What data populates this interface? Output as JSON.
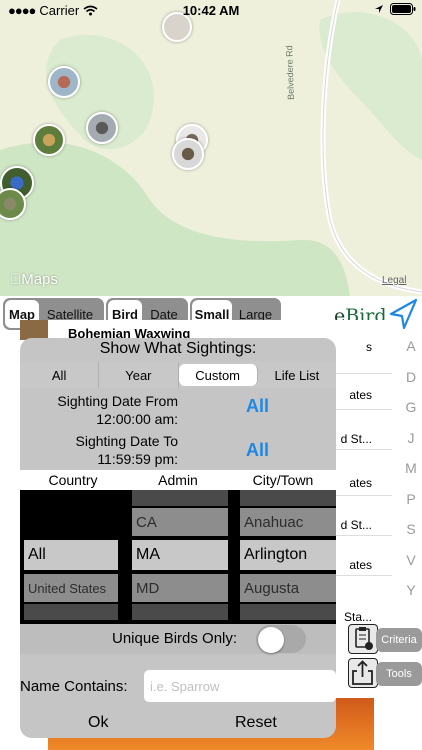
{
  "status": {
    "carrier": "Carrier",
    "time": "10:42 AM"
  },
  "map": {
    "road_label": "Belvedere Rd",
    "logo": "Maps",
    "legal": "Legal"
  },
  "map_type": {
    "options": [
      "Map",
      "Satellite"
    ],
    "selected": "Map"
  },
  "sort_by": {
    "options": [
      "Bird",
      "Date"
    ],
    "selected": "Bird"
  },
  "marker_size": {
    "options": [
      "Small",
      "Large"
    ],
    "selected": "Small"
  },
  "brand": {
    "logo_e": "e",
    "logo_bird": "Bird",
    "icon": "location-arrow-icon"
  },
  "list": {
    "visible_title": "Bohemian Waxwing",
    "rows": [
      "s",
      "ates",
      "d St...",
      "ates",
      "d St...",
      "ates",
      "Sta..."
    ]
  },
  "index_letters": [
    "A",
    "D",
    "G",
    "J",
    "M",
    "P",
    "S",
    "V",
    "Y"
  ],
  "panel": {
    "title": "Show What Sightings:",
    "tabs": [
      "All",
      "Year",
      "Custom",
      "Life List"
    ],
    "selected_tab": "Custom",
    "date_from_label_1": "Sighting Date From",
    "date_from_label_2": "12:00:00 am:",
    "date_from_value": "All",
    "date_to_label_1": "Sighting Date To",
    "date_to_label_2": "11:59:59 pm:",
    "date_to_value": "All",
    "picker_headers": [
      "Country",
      "Admin",
      "City/Town"
    ],
    "country": {
      "above": [],
      "selected": "All",
      "below": [
        "United States"
      ]
    },
    "admin": {
      "above": [
        "CA"
      ],
      "selected": "MA",
      "below": [
        "MD"
      ]
    },
    "city": {
      "above": [
        "Anahuac"
      ],
      "selected": "Arlington",
      "below": [
        "Augusta"
      ]
    },
    "unique_label": "Unique Birds Only:",
    "unique_on": false,
    "name_label": "Name Contains:",
    "name_value": "",
    "name_placeholder": "i.e. Sparrow",
    "ok_label": "Ok",
    "reset_label": "Reset"
  },
  "side": {
    "criteria_label": "Criteria",
    "tools_label": "Tools"
  },
  "colors": {
    "accent": "#1e88e5",
    "ebird_green": "#1a6b3a",
    "map_land": "#eef0dc",
    "map_park": "#cfe6c5"
  }
}
